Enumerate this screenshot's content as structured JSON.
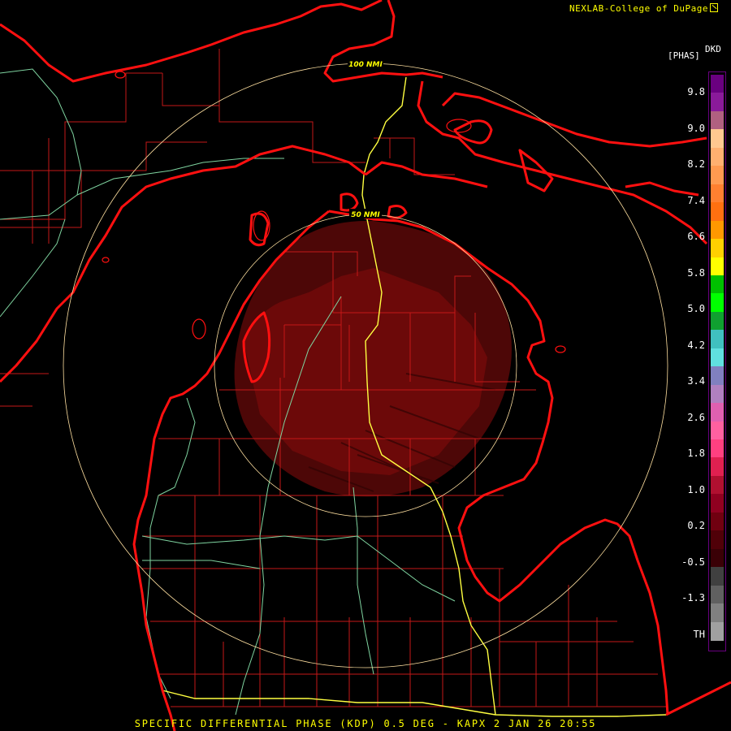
{
  "header": {
    "credit": "NEXLAB-College of DuPage",
    "credit_icon": "nexlab-logo-icon"
  },
  "legend": {
    "product_code": "DKD",
    "unit": "[PHAS]",
    "tick_labels": [
      "9.8",
      "9.0",
      "8.2",
      "7.4",
      "6.6",
      "5.8",
      "5.0",
      "4.2",
      "3.4",
      "2.6",
      "1.8",
      "1.0",
      "0.2",
      "-0.5",
      "-1.3",
      "TH"
    ],
    "colors": [
      "#6a0080",
      "#8a1a9a",
      "#b06080",
      "#ffc890",
      "#ffb070",
      "#ff9a50",
      "#ff8030",
      "#ff7010",
      "#ff9800",
      "#ffd000",
      "#ffff00",
      "#00c000",
      "#00ff00",
      "#10a030",
      "#40c0c0",
      "#60e0e0",
      "#8080c0",
      "#b080c0",
      "#e060b0",
      "#ff60a0",
      "#ff4080",
      "#e02050",
      "#b01030",
      "#900020",
      "#700010",
      "#500008",
      "#3a0006",
      "#404040",
      "#606060",
      "#808080",
      "#a0a0a0"
    ]
  },
  "rings": {
    "outer_label": "100 NMI",
    "inner_label": "50 NMI"
  },
  "footer": {
    "title": "SPECIFIC DIFFERENTIAL PHASE (KDP) 0.5 DEG - KAPX 2 JAN 26 20:55"
  },
  "colors": {
    "coast": "#ff1010",
    "county": "#c41818",
    "highway_primary": "#ffff40",
    "highway_secondary": "#7fd4a0",
    "range_ring": "#ffe0a0",
    "echo": "#6a0a0a"
  }
}
